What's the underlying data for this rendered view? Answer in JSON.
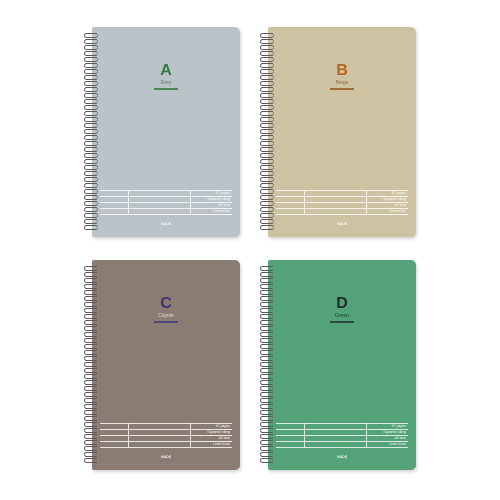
{
  "notebooks": [
    {
      "letter": "A",
      "subtitle": "Grey",
      "cover_color": "#bac3c8",
      "letter_color": "#2e7d3e",
      "subtitle_color": "#4f7d5a",
      "rule_color": "#4a8a55",
      "lines": [
        "97 pages",
        "Squared ruling",
        "A5 size",
        "Lined book"
      ],
      "brand": "MADE"
    },
    {
      "letter": "B",
      "subtitle": "Beige",
      "cover_color": "#cdc3a2",
      "letter_color": "#b5651d",
      "subtitle_color": "#8f6b45",
      "rule_color": "#a06a3a",
      "lines": [
        "97 pages",
        "Squared ruling",
        "A5 size",
        "Lined book"
      ],
      "brand": "MADE"
    },
    {
      "letter": "C",
      "subtitle": "Coyote",
      "cover_color": "#8b7c73",
      "letter_color": "#3b3470",
      "subtitle_color": "#e3ddd8",
      "rule_color": "#4e4680",
      "lines": [
        "97 pages",
        "Squared ruling",
        "A5 size",
        "Lined book"
      ],
      "brand": "MADE"
    },
    {
      "letter": "D",
      "subtitle": "Green",
      "cover_color": "#53a278",
      "letter_color": "#1e2b2a",
      "subtitle_color": "#1e3a32",
      "rule_color": "#2c4a3f",
      "lines": [
        "97 pages",
        "Squared ruling",
        "A5 size",
        "Lined book"
      ],
      "brand": "MADE"
    }
  ]
}
